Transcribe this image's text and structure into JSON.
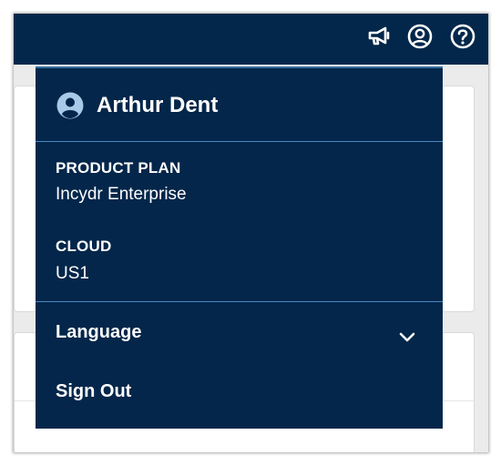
{
  "topbar": {
    "icons": [
      "megaphone-icon",
      "user-circle-icon",
      "help-circle-icon"
    ]
  },
  "menu": {
    "user_name": "Arthur Dent",
    "product_plan_label": "PRODUCT PLAN",
    "product_plan_value": "Incydr Enterprise",
    "cloud_label": "CLOUD",
    "cloud_value": "US1",
    "language_label": "Language",
    "sign_out_label": "Sign Out"
  },
  "colors": {
    "navy": "#03264a",
    "divider": "#4b87c4",
    "avatar": "#a9c9e8"
  }
}
